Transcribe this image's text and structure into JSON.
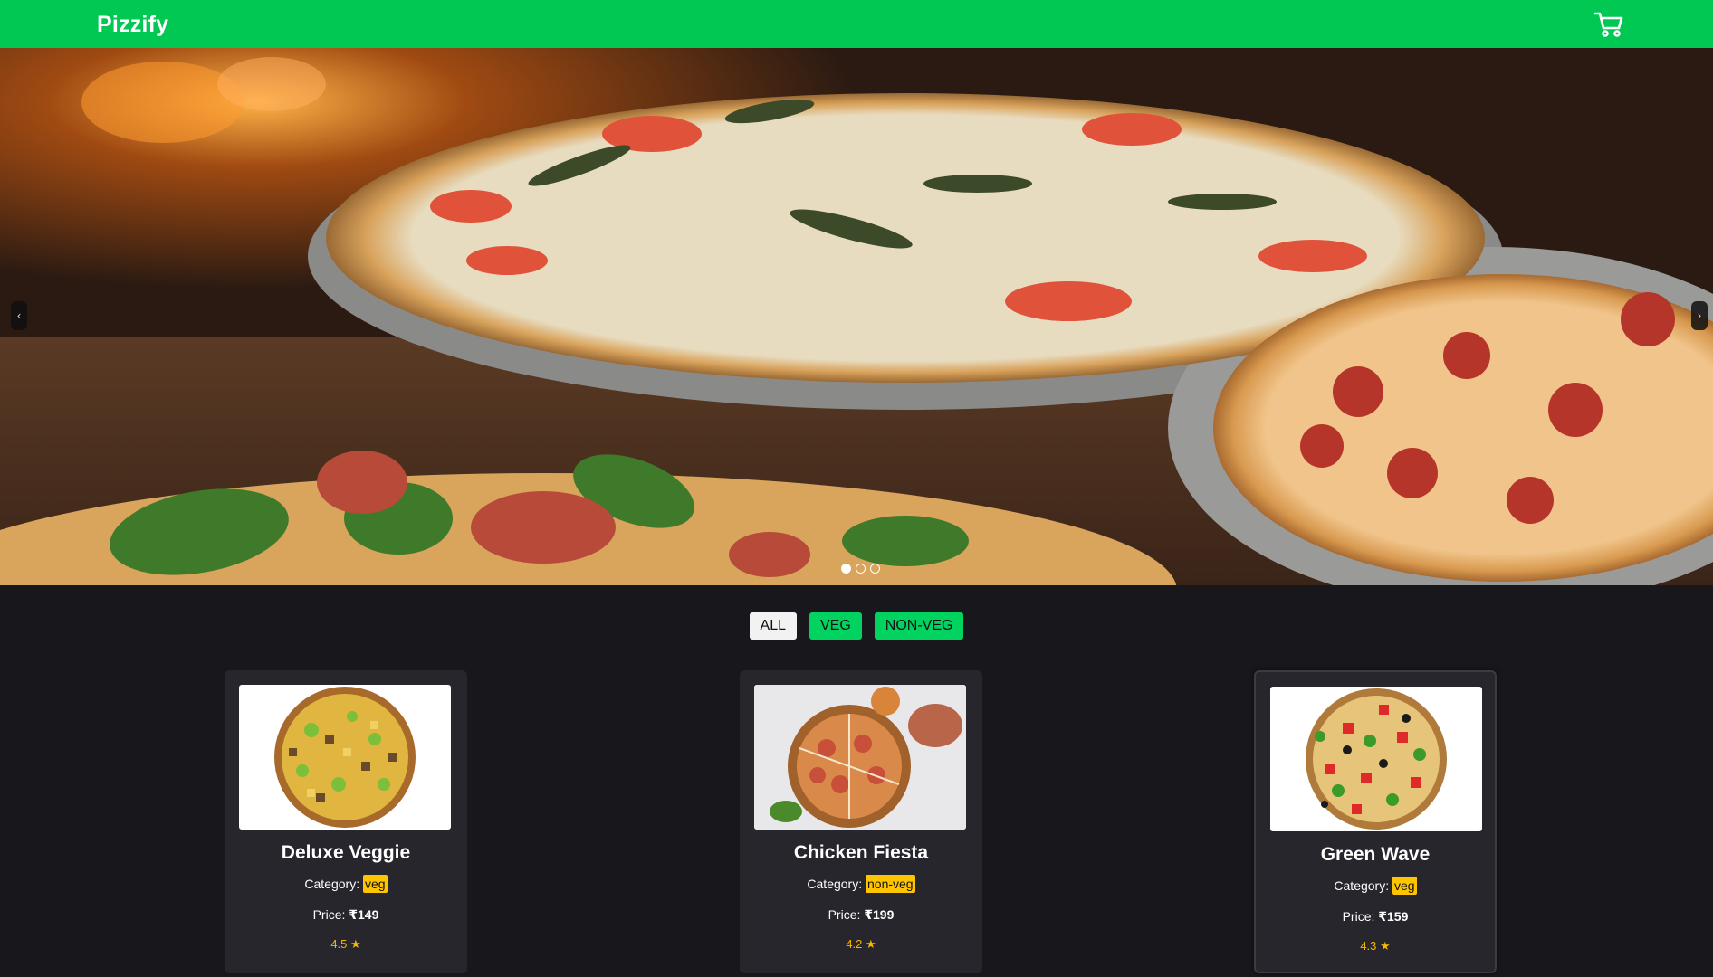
{
  "navbar": {
    "brand": "Pizzify",
    "cart_icon": "shopping-cart-icon"
  },
  "hero": {
    "prev_label": "‹",
    "next_label": "›",
    "slides": 3,
    "active_slide": 1
  },
  "filters": {
    "all": "ALL",
    "veg": "VEG",
    "nonveg": "NON-VEG"
  },
  "products": [
    {
      "name": "Deluxe Veggie",
      "category_label": "Category:",
      "category": "veg",
      "price_label": "Price:",
      "price": "₹149",
      "rating": "4.5 ★"
    },
    {
      "name": "Chicken Fiesta",
      "category_label": "Category:",
      "category": "non-veg",
      "price_label": "Price:",
      "price": "₹199",
      "rating": "4.2 ★"
    },
    {
      "name": "Green Wave",
      "category_label": "Category:",
      "category": "veg",
      "price_label": "Price:",
      "price": "₹159",
      "rating": "4.3 ★"
    }
  ],
  "colors": {
    "accent": "#00c853",
    "background": "#18181c",
    "card": "#26262c",
    "tag": "#ffc400",
    "rating": "#f5b700"
  }
}
